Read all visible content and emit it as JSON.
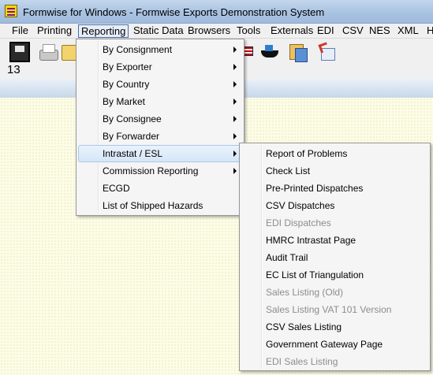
{
  "window": {
    "title": "Formwise for Windows - Formwise Exports Demonstration System"
  },
  "menubar": {
    "items": [
      "File",
      "Printing",
      "Reporting",
      "Static Data",
      "Browsers",
      "Tools",
      "Externals",
      "EDI",
      "CSV",
      "NES",
      "XML",
      "H"
    ],
    "active": "Reporting"
  },
  "toolbar": {
    "icons": [
      "floppy-icon",
      "printer-icon",
      "folder-icon",
      "flag-icon",
      "ship-icon",
      "documents-icon",
      "refresh-icon"
    ],
    "count": "13"
  },
  "reporting_menu": {
    "items": [
      {
        "label": "By Consignment",
        "submenu": true
      },
      {
        "label": "By Exporter",
        "submenu": true
      },
      {
        "label": "By Country",
        "submenu": true
      },
      {
        "label": "By Market",
        "submenu": true
      },
      {
        "label": "By Consignee",
        "submenu": true
      },
      {
        "label": "By Forwarder",
        "submenu": true
      },
      {
        "label": "Intrastat / ESL",
        "submenu": true,
        "highlighted": true
      },
      {
        "label": "Commission Reporting",
        "submenu": true
      },
      {
        "label": "ECGD",
        "submenu": false
      },
      {
        "label": "List of Shipped Hazards",
        "submenu": false
      }
    ]
  },
  "intrastat_menu": {
    "items": [
      {
        "label": "Report of Problems",
        "enabled": true
      },
      {
        "label": "Check List",
        "enabled": true
      },
      {
        "label": "Pre-Printed Dispatches",
        "enabled": true
      },
      {
        "label": "CSV Dispatches",
        "enabled": true
      },
      {
        "label": "EDI Dispatches",
        "enabled": false
      },
      {
        "label": "HMRC Intrastat Page",
        "enabled": true
      },
      {
        "label": "Audit Trail",
        "enabled": true
      },
      {
        "label": "EC List of Triangulation",
        "enabled": true
      },
      {
        "label": "Sales Listing (Old)",
        "enabled": false
      },
      {
        "label": "Sales Listing VAT 101 Version",
        "enabled": false
      },
      {
        "label": "CSV Sales Listing",
        "enabled": true
      },
      {
        "label": "Government Gateway Page",
        "enabled": true
      },
      {
        "label": "EDI Sales Listing",
        "enabled": false
      }
    ]
  }
}
